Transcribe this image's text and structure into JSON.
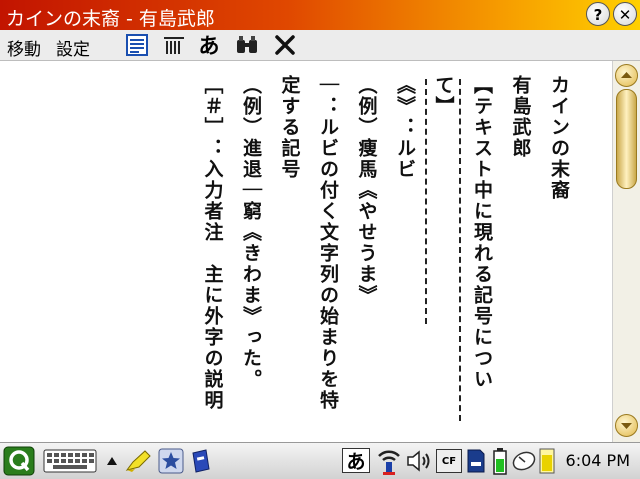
{
  "window": {
    "title": "カインの末裔 - 有島武郎"
  },
  "titlebar": {
    "help_glyph": "?",
    "close_glyph": "✕"
  },
  "menu": {
    "items": [
      "移動",
      "設定"
    ]
  },
  "toolbar": {
    "font_label": "あ"
  },
  "document": {
    "columns": [
      "カインの末裔",
      "有島武郎",
      "",
      "【テキスト中に現れる記号につい",
      "て】",
      "",
      "《》：ルビ",
      "（例）痩馬《やせうま》",
      "｜：ルビの付く文字列の始まりを特",
      "定する記号",
      "（例）進退｜窮《きわま》った。",
      "［＃］：入力者注　主に外字の説明"
    ]
  },
  "taskbar": {
    "ime_label": "あ",
    "cf_label": "CF",
    "clock": "6:04 PM"
  },
  "colors": {
    "title_start": "#c21400",
    "title_end": "#ffd000",
    "accent_gold": "#e1b84a"
  }
}
